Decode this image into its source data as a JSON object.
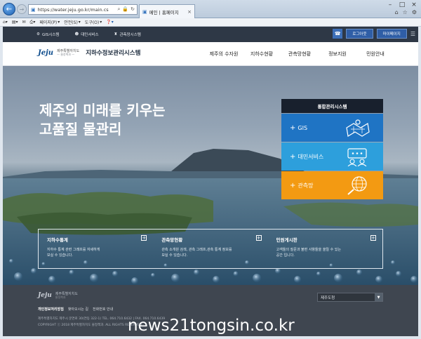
{
  "browser": {
    "url": "https://water.jeju.go.kr/main.cs",
    "tab_title": "메인 | 홈페이지",
    "window_controls": [
      "–",
      "□",
      "×"
    ],
    "toolbar_icons": [
      "home-icon",
      "star-icon",
      "gear-icon"
    ],
    "command_bar": [
      {
        "icon": "home-icon",
        "label": ""
      },
      {
        "icon": "feed-icon",
        "label": ""
      },
      {
        "icon": "mail-icon",
        "label": ""
      },
      {
        "icon": "print-icon",
        "label": ""
      },
      {
        "label": "페이지(P)"
      },
      {
        "label": "안전(S)"
      },
      {
        "label": "도구(O)"
      },
      {
        "icon": "help-icon",
        "label": ""
      }
    ]
  },
  "util_bar": {
    "items": [
      {
        "icon": "gear-icon",
        "label": "GIS시스템"
      },
      {
        "icon": "user-icon",
        "label": "대민서비스"
      },
      {
        "icon": "building-icon",
        "label": "관측망시스템"
      }
    ],
    "headset_icon": "headset-icon",
    "logout_label": "로그아웃",
    "mypage_label": "마이페이지",
    "menu_icon": "menu-icon"
  },
  "header": {
    "logo_text": "Jeju",
    "org_name": "제주특별자치도",
    "org_sub": "— 물정책과 —",
    "site_title": "지하수정보관리시스템",
    "nav": [
      "제주의 수자원",
      "지하수현황",
      "관측망현황",
      "정보지원",
      "민원안내"
    ]
  },
  "hero": {
    "title_line1": "제주의 미래를 키우는",
    "title_line2": "고품질 물관리",
    "panel_title": "통합관리시스템",
    "systems": [
      {
        "label": "GIS",
        "icon": "map-icon",
        "color": "#1f74c4"
      },
      {
        "label": "대민서비스",
        "icon": "chat-icon",
        "color": "#2d9fdc"
      },
      {
        "label": "관측망",
        "icon": "globe-search-icon",
        "color": "#f39a12"
      }
    ]
  },
  "info": [
    {
      "title": "지하수통계",
      "desc_line1": "지하수 통계 관련 그래프를 자세하게",
      "desc_line2": "보실 수 있습니다."
    },
    {
      "title": "관측망현황",
      "desc_line1": "관측 소개원 검색, 관측 그래프,관측 통계 정보를",
      "desc_line2": "보실 수 있습니다."
    },
    {
      "title": "민원게시판",
      "desc_line1": "고객들의 질문과 불편 사항들을 올릴 수 있는",
      "desc_line2": "공간 입니다."
    }
  ],
  "footer": {
    "logo_text": "Jeju",
    "org_name": "제주특별자치도",
    "org_sub": "물정책과",
    "links": [
      "개인정보처리방침",
      "찾아오시는 길",
      "전화번호 안내"
    ],
    "address": "제주특별자치도 제주시 문연로 30(연동 322-1) TEL. 064.710.6432 | FAX. 064.710.6439",
    "copyright": "COPYRIGHT ⓒ 2018 제주특별자치도 물정책과. ALL RIGHTS RESERVED",
    "select_value": "제주도청"
  },
  "watermark": "news21tongsin.co.kr"
}
